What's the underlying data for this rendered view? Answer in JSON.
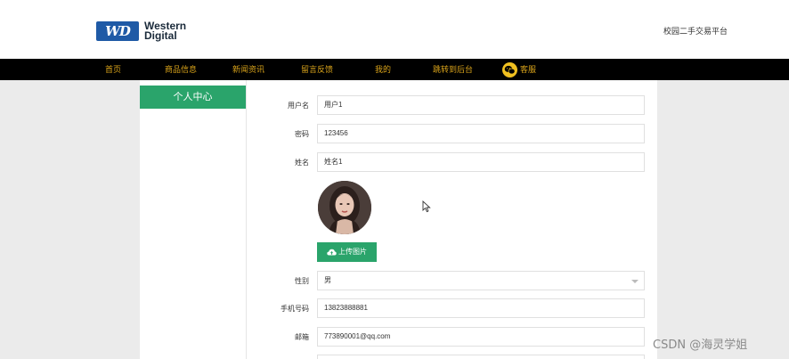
{
  "header": {
    "logo_mark": "WD",
    "logo_line1": "Western",
    "logo_line2": "Digital",
    "site_title": "校园二手交易平台"
  },
  "nav": {
    "items": [
      "首页",
      "商品信息",
      "新闻资讯",
      "留言反馈",
      "我的",
      "跳转到后台",
      "客服"
    ]
  },
  "sidebar": {
    "header": "个人中心"
  },
  "form": {
    "username": {
      "label": "用户名",
      "value": "用户1"
    },
    "password": {
      "label": "密码",
      "value": "123456"
    },
    "name": {
      "label": "姓名",
      "value": "姓名1"
    },
    "upload_button": "上传图片",
    "gender": {
      "label": "性别",
      "value": "男"
    },
    "phone": {
      "label": "手机号码",
      "value": "13823888881"
    },
    "email": {
      "label": "邮箱",
      "value": "773890001@qq.com"
    }
  },
  "watermark": "CSDN @海灵学姐",
  "colors": {
    "accent": "#2aa46b",
    "nav_text": "#d9a31a",
    "nav_bg": "#000000"
  }
}
